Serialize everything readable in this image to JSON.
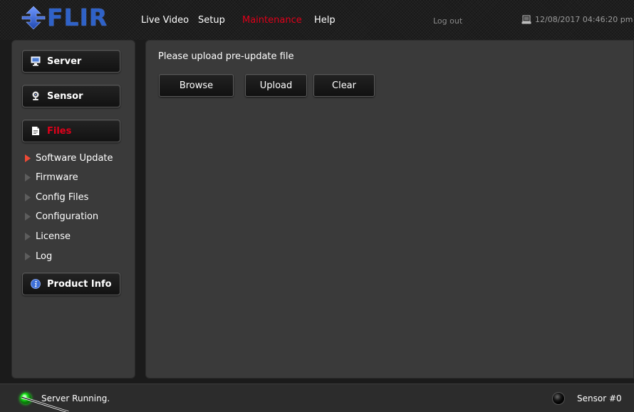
{
  "brand": {
    "name": "FLIR"
  },
  "nav": {
    "items": [
      {
        "label": "Live Video",
        "active": false
      },
      {
        "label": "Setup",
        "active": false
      },
      {
        "label": "Maintenance",
        "active": true
      },
      {
        "label": "Help",
        "active": false
      }
    ],
    "logout": "Log out",
    "datetime": "12/08/2017 04:46:20 pm"
  },
  "sidebar": {
    "buttons": {
      "server": {
        "label": "Server",
        "icon": "monitor-icon"
      },
      "sensor": {
        "label": "Sensor",
        "icon": "camera-icon"
      },
      "files": {
        "label": "Files",
        "icon": "document-icon",
        "active": true
      },
      "product_info": {
        "label": "Product Info",
        "icon": "info-icon"
      }
    },
    "sub_items": [
      {
        "label": "Software Update",
        "active": true
      },
      {
        "label": "Firmware",
        "active": false
      },
      {
        "label": "Config Files",
        "active": false
      },
      {
        "label": "Configuration",
        "active": false
      },
      {
        "label": "License",
        "active": false
      },
      {
        "label": "Log",
        "active": false
      }
    ]
  },
  "main": {
    "prompt": "Please upload pre-update file",
    "buttons": {
      "browse": "Browse",
      "upload": "Upload",
      "clear": "Clear"
    }
  },
  "status": {
    "server_text": "Server Running.",
    "server_state": "running",
    "sensor_label": "Sensor #0",
    "sensor_state": "off"
  },
  "colors": {
    "accent": "#e0001a",
    "brand": "#2f62c8",
    "led_on": "#1ee81e",
    "panel": "#3a3a3a",
    "background": "#1b1b1b"
  }
}
